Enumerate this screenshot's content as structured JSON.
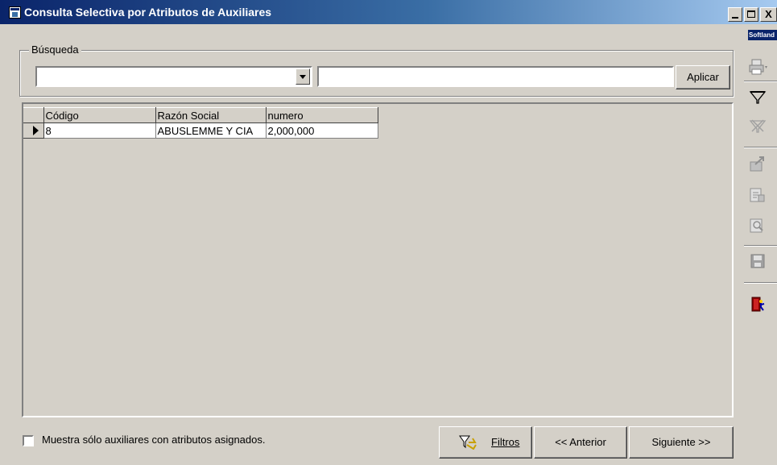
{
  "window": {
    "title": "Consulta Selectiva por Atributos de Auxiliares",
    "minimize": "_",
    "close": "X"
  },
  "brand": "Softland",
  "search": {
    "group_label": "Búsqueda",
    "combo_value": "",
    "text_value": "",
    "apply_label": "Aplicar"
  },
  "grid": {
    "columns": [
      "Código",
      "Razón Social",
      "numero"
    ],
    "rows": [
      {
        "codigo": "8",
        "razon_social": "ABUSLEMME Y CIA",
        "numero": "2,000,000"
      }
    ]
  },
  "filter_checkbox": {
    "label": "Muestra sólo auxiliares con atributos asignados.",
    "checked": false
  },
  "buttons": {
    "filtros": "Filtros",
    "anterior": "<< Anterior",
    "siguiente": "Siguiente >>"
  },
  "toolbar_icons": [
    "printer-icon",
    "filter-icon",
    "clear-filter-icon",
    "export-icon",
    "properties-icon",
    "lookup-icon",
    "save-icon",
    "exit-icon"
  ],
  "colors": {
    "title_start": "#0a246a",
    "title_end": "#a6caf0",
    "face": "#d4d0c8"
  }
}
